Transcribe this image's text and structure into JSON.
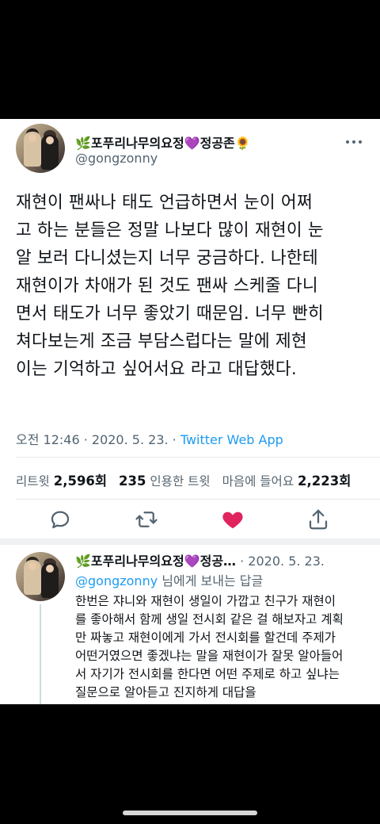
{
  "tweet": {
    "display_name": "🌿포푸리나무의요정💜정공존🌻",
    "handle": "@gongzonny",
    "lines": [
      "재현이 팬싸나 태도 언급하면서 눈이 어쩌",
      "고 하는 분들은 정말 나보다 많이 재현이 눈",
      "알 보러 다니셨는지 너무 궁금하다. 나한테",
      "재현이가 차애가 된 것도 팬싸 스케줄 다니",
      "면서 태도가 너무 좋았기 때문임. 너무 빤히",
      "쳐다보는게 조금 부담스럽다는 말에 제현",
      "이는 기억하고 싶어서요 라고 대답했다."
    ],
    "timestamp": "오전 12:46 · 2020. 5. 23. · ",
    "source": "Twitter Web App",
    "retweets_label": "리트윗",
    "retweets_count": "2,596회",
    "quotes_count": "235",
    "quotes_label": "인용한 트윗",
    "likes_label": "마음에 들어요",
    "likes_count": "2,223회"
  },
  "actions": {
    "reply_icon": "reply-icon",
    "retweet_icon": "retweet-icon",
    "like_icon": "heart-filled-icon",
    "share_icon": "share-icon",
    "like_color": "#e0245e"
  },
  "reply": {
    "display_name": "🌿포푸리나무의요정💜정공…",
    "date": " · 2020. 5. 23.",
    "reply_to_handle": "@gongzonny",
    "reply_to_suffix": " 님에게 보내는 답글",
    "lines": [
      "한번은 쟈니와 재현이 생일이 가깝고 친구가 재현이",
      "를 좋아해서 함께 생일 전시회 같은 걸 해보자고 계획",
      "만 짜놓고 재현이에게 가서 전시회를 할건데 주제가",
      "어떤거였으면 좋겠냐는 말을 재현이가 잘못 알아들어",
      "서 자기가 전시회를 한다면 어떤 주제로 하고 싶냐는",
      "질문으로 알아듣고 진지하게 대답을"
    ]
  }
}
